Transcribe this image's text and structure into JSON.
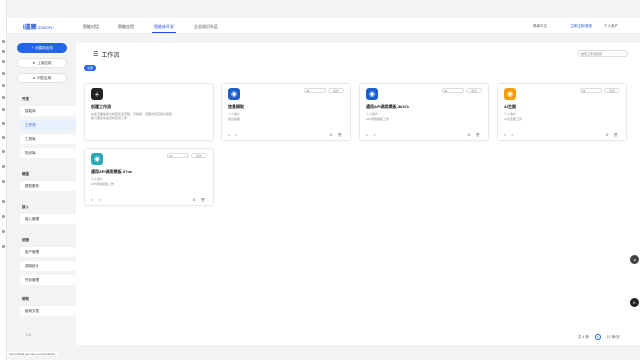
{
  "app": {
    "logo": "I道雁",
    "logo_sub": "GOMOPU"
  },
  "nav": {
    "tabs": [
      "智能对话",
      "智能应用",
      "智能体开发",
      "企业知识社区"
    ],
    "active_index": 2
  },
  "topright": {
    "language": "简体中文",
    "login": "立即注册/登录",
    "user": "个人用户"
  },
  "sidebar": {
    "primary_button": "创建新应用",
    "buttons": [
      "上架应用",
      "问答应用"
    ],
    "groups": [
      {
        "title": "开发",
        "items": [
          "智能体",
          "工作流",
          "工具库",
          "知识库"
        ],
        "active": "工作流"
      },
      {
        "title": "模型",
        "items": [
          "模型服务"
        ]
      },
      {
        "title": "接入",
        "items": [
          "接入管理"
        ]
      },
      {
        "title": "运营",
        "items": [
          "用户管理",
          "调用统计",
          "任务管理"
        ]
      },
      {
        "title": "帮助",
        "items": [
          "使用文档"
        ]
      }
    ],
    "footer": "1.0"
  },
  "main": {
    "title": "工作流",
    "search_placeholder": "搜索工作流名称",
    "filter_all": "全部",
    "new_card": {
      "icon": "+",
      "name": "创建工作流",
      "desc": "在此页面编排大模型任务流程，可编排、流程对接应用大模型",
      "desc2": "助力团队快速完成复杂工作"
    },
    "cards": [
      {
        "name": "信息摘取",
        "author": "个人用户",
        "desc": "信息提取",
        "version": "v4",
        "publish": "发布",
        "icon_color": "#1e5fcf",
        "runs": "0",
        "likes": "0"
      },
      {
        "name": "通用API调用模板-3k37c",
        "author": "个人用户",
        "desc": "API调用模板工作",
        "version": "v4",
        "publish": "发布",
        "icon_color": "#1e5fcf",
        "runs": "0",
        "likes": "0"
      },
      {
        "name": "AI生图",
        "author": "个人用户",
        "desc": "AI文生图工作",
        "version": "v4",
        "publish": "发布",
        "icon_color": "#f59e0b",
        "runs": "0",
        "likes": "0"
      },
      {
        "name": "通用API调用模板-07ue",
        "author": "个人用户",
        "desc": "API调用模板工作",
        "version": "v4",
        "publish": "发布",
        "icon_color": "#2aa7b5",
        "runs": "0",
        "likes": "0"
      }
    ]
  },
  "pager": {
    "total": "共 4 条",
    "page": "1",
    "per_page": "12 条/页"
  },
  "url": "https://bisai.gomopu.com/workflow"
}
